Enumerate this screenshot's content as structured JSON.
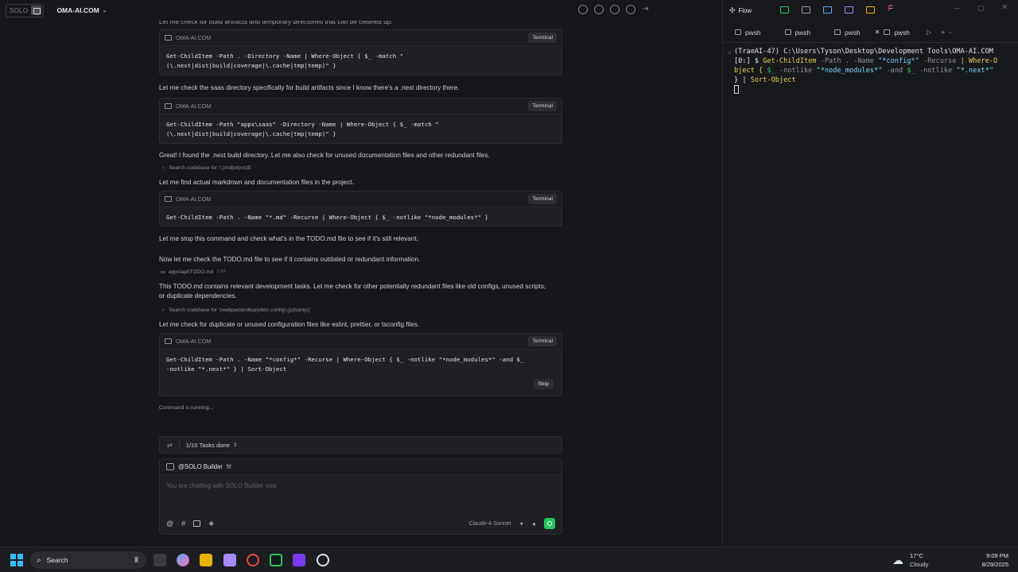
{
  "topbar": {
    "logo_text": "SOLO",
    "workspace": "OMA-AI.COM"
  },
  "chat": {
    "intro_partial": "Let me check for build artifacts and temporary directories that can be cleaned up:",
    "card1": {
      "title": "OMA-AI.COM",
      "button": "Terminal",
      "cmd": "Get-ChildItem -Path . -Directory -Name | Where-Object { $_ -match \"(\\.next|dist|build|coverage|\\.cache|tmp|temp)\" }"
    },
    "msg2": "Let me check the saas directory specifically for build artifacts since I know there's a .next directory there.",
    "card2": {
      "title": "OMA-AI.COM",
      "button": "Terminal",
      "cmd": "Get-ChildItem -Path \"apps\\saas\" -Directory -Name | Where-Object { $_ -match \"(\\.next|dist|build|coverage|\\.cache|tmp|temp)\" }"
    },
    "msg3": "Great! I found the .next build directory. Let me also check for unused documentation files and other redundant files.",
    "search1": "Search codebase for '\\.(md|txt|rst)$'",
    "msg4": "Let me find actual markdown and documentation files in the project.",
    "card3": {
      "title": "OMA-AI.COM",
      "button": "Terminal",
      "cmd": "Get-ChildItem -Path . -Name \"*.md\" -Recurse | Where-Object { $_ -notlike \"*node_modules*\" }"
    },
    "msg5": "Let me stop this command and check what's in the TODO.md file to see if it's still relevant.",
    "msg6": "Now let me check the TODO.md file to see if it contains outdated or redundant information.",
    "file1": "apps\\api\\TODO.md",
    "file1_range": "1-50",
    "msg7": "This TODO.md contains relevant development tasks. Let me check for other potentially redundant files like old configs, unused scripts, or duplicate dependencies.",
    "search2": "Search codebase for '(webpack|rollup|vite)\\.config\\.(js|ts|mjs)'",
    "msg8": "Let me check for duplicate or unused configuration files like eslint, prettier, or tsconfig files.",
    "card4": {
      "title": "OMA-AI.COM",
      "button": "Terminal",
      "cmd": "Get-ChildItem -Path . -Name \"*config*\" -Recurse | Where-Object { $_ -notlike \"*node_modules*\" -and $_\n-notlike \"*.next*\" } | Sort-Object",
      "skip": "Skip"
    },
    "status": "Command is running..."
  },
  "tasks": {
    "label": "1/10 Tasks done"
  },
  "input": {
    "agent": "@SOLO Builder",
    "placeholder": "You are chatting with SOLO Builder now",
    "model": "Claude-4-Sonnet"
  },
  "right": {
    "flow": "Flow",
    "tabs": [
      "pwsh",
      "pwsh",
      "pwsh",
      "pwsh"
    ],
    "term_line1": "(TraeAI-47) C:\\Users\\Tyson\\Desktop\\Development Tools\\OMA-AI.COM",
    "term_prompt": "[0:] $ ",
    "term_cmd1": "Get-ChildItem",
    "term_p1": " -Path . -Name ",
    "term_s1": "\"*config*\"",
    "term_p2": " -Recurse ",
    "term_pipe": "| Where-O",
    "term_l3a": "bject { ",
    "term_l3b": "$_",
    "term_l3c": " -notlike ",
    "term_l3d": "\"*node_modules*\"",
    "term_l3e": " -and ",
    "term_l3f": "$_",
    "term_l3g": " -notlike ",
    "term_l3h": "\"*.next*\"",
    "term_l4a": "} | ",
    "term_l4b": "Sort-Object"
  },
  "taskbar": {
    "search": "Search",
    "weather_temp": "17°C",
    "weather_desc": "Cloudy",
    "time": "9:09 PM",
    "date": "8/29/2025"
  },
  "colors": {
    "bg": "#16171a",
    "card": "#1f2024",
    "accent_green": "#22c55e",
    "yellow": "#e6d35a",
    "cyan": "#7dd3fc"
  }
}
